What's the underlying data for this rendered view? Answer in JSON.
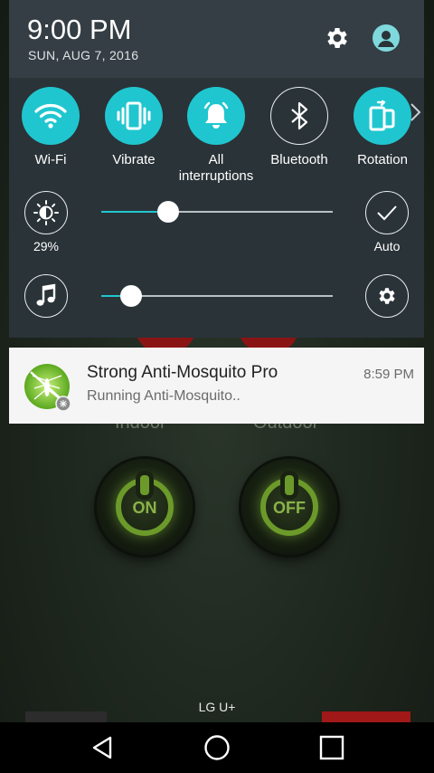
{
  "status": {
    "time": "9:00 PM",
    "date": "SUN, AUG 7, 2016"
  },
  "header_icons": [
    "gear-icon",
    "user-icon"
  ],
  "quick_settings": [
    {
      "label": "Wi-Fi",
      "icon": "wifi-icon",
      "active": true
    },
    {
      "label": "Vibrate",
      "icon": "vibrate-icon",
      "active": true
    },
    {
      "label": "All\ninterruptions",
      "icon": "bell-icon",
      "active": true
    },
    {
      "label": "Bluetooth",
      "icon": "bluetooth-icon",
      "active": false
    },
    {
      "label": "Rotation",
      "icon": "rotation-icon",
      "active": true
    }
  ],
  "brightness": {
    "label": "29%",
    "level": 0.29,
    "auto_label": "Auto"
  },
  "volume": {
    "level": 0.13
  },
  "notification": {
    "title": "Strong Anti-Mosquito Pro",
    "text": "Running Anti-Mosquito..",
    "time": "8:59 PM"
  },
  "app": {
    "indoor_label": "Indoor",
    "outdoor_label": "Outdoor",
    "on_label": "ON",
    "off_label": "OFF"
  },
  "carrier": "LG U+",
  "colors": {
    "accent": "#20c6cf",
    "shade_bg": "#2a3338",
    "header_bg": "#343e44"
  }
}
